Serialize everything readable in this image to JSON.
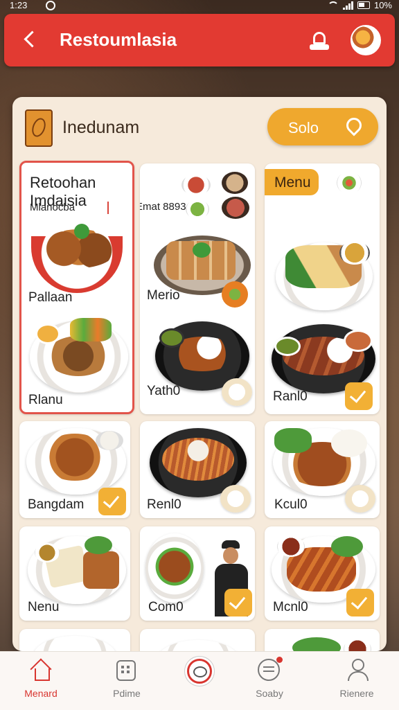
{
  "status": {
    "time": "1:23",
    "battery": "10%"
  },
  "header": {
    "title": "Restoumlasia"
  },
  "panel": {
    "brand": "Inedunam",
    "solo_button": "Solo"
  },
  "featured": {
    "title": "Retoohan Imdaisia",
    "subtitle_left": "Mlanocba",
    "subtitle_right": "Emat 8893"
  },
  "menu_badge": "Menu",
  "cards": [
    {
      "label": "Pallaan"
    },
    {
      "label": "Rlanu"
    },
    {
      "label": "Merio"
    },
    {
      "label": "Yath0"
    },
    {
      "label": "Ranl0"
    },
    {
      "label": "Bangdam"
    },
    {
      "label": "Renl0"
    },
    {
      "label": "Kcul0"
    },
    {
      "label": "Nenu"
    },
    {
      "label": "Com0"
    },
    {
      "label": "Mcnl0"
    }
  ],
  "nav": [
    {
      "label": "Menard",
      "icon": "home-icon"
    },
    {
      "label": "Pdime",
      "icon": "grid-icon"
    },
    {
      "label": "",
      "icon": "chat-icon"
    },
    {
      "label": "Soaby",
      "icon": "message-icon"
    },
    {
      "label": "Rienere",
      "icon": "user-icon"
    }
  ],
  "colors": {
    "header": "#e23a32",
    "accent": "#efa82e",
    "panel": "#f6eadb"
  }
}
